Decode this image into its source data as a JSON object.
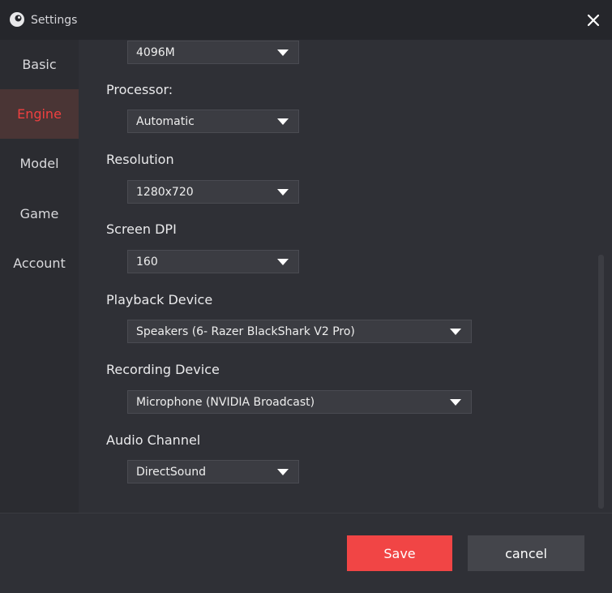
{
  "window": {
    "title": "Settings",
    "logo_icon": "app-logo-icon",
    "close_icon": "close-icon"
  },
  "sidebar": {
    "items": [
      {
        "label": "Basic",
        "active": false
      },
      {
        "label": "Engine",
        "active": true
      },
      {
        "label": "Model",
        "active": false
      },
      {
        "label": "Game",
        "active": false
      },
      {
        "label": "Account",
        "active": false
      }
    ]
  },
  "settings": {
    "memory": {
      "value": "4096M"
    },
    "processor": {
      "label": "Processor:",
      "value": "Automatic"
    },
    "resolution": {
      "label": "Resolution",
      "value": "1280x720"
    },
    "screen_dpi": {
      "label": "Screen DPI",
      "value": "160"
    },
    "playback_device": {
      "label": "Playback Device",
      "value": "Speakers (6- Razer BlackShark V2 Pro)"
    },
    "recording_device": {
      "label": "Recording Device",
      "value": "Microphone (NVIDIA Broadcast)"
    },
    "audio_channel": {
      "label": "Audio Channel",
      "value": "DirectSound"
    }
  },
  "footer": {
    "save_label": "Save",
    "cancel_label": "cancel"
  },
  "colors": {
    "accent": "#f14545",
    "background": "#2f3036",
    "titlebar": "#25262b",
    "active_nav_bg": "#4a3535"
  }
}
